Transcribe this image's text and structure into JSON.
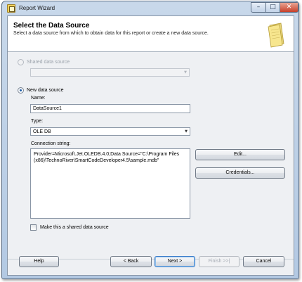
{
  "window": {
    "title": "Report Wizard",
    "controls": {
      "minimize": "–",
      "maximize": "□",
      "close": "✕"
    }
  },
  "header": {
    "title": "Select the Data Source",
    "subtitle": "Select a data source from which to obtain data for this report or create a new data source."
  },
  "shared_source": {
    "label": "Shared data source",
    "selected": false,
    "enabled": false,
    "combo_value": ""
  },
  "new_source": {
    "label": "New data source",
    "selected": true,
    "name_label": "Name:",
    "name_value": "DataSource1",
    "type_label": "Type:",
    "type_value": "OLE DB",
    "connection_label": "Connection string:",
    "connection_value": "Provider=Microsoft.Jet.OLEDB.4.0;Data Source=\"C:\\Program Files (x86)\\TechnoRiver\\SmartCodeDeveloper4.5\\sample.mdb\"",
    "edit_button": "Edit...",
    "credentials_button": "Credentials...",
    "shared_checkbox_label": "Make this a shared data source",
    "shared_checkbox_checked": false
  },
  "footer": {
    "help": "Help",
    "back": "< Back",
    "next": "Next >",
    "finish": "Finish >>|",
    "cancel": "Cancel"
  },
  "icons": {
    "app": "report-wizard-icon",
    "header": "report-document-icon",
    "dropdown": "chevron-down-icon"
  }
}
